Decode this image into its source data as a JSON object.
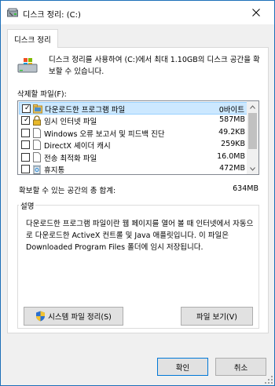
{
  "window": {
    "title": "디스크 정리: (C:)",
    "icons": {
      "title": "disk-cleanup-icon",
      "close": "close-icon"
    }
  },
  "tabs": [
    {
      "label": "디스크 정리",
      "active": true
    }
  ],
  "intro": {
    "icon": "drive-icon",
    "text": "디스크 정리를 사용하여 (C:)에서 최대 1.10GB의 디스크 공간을 확보할 수 있습니다."
  },
  "files_label": "삭제할 파일(F):",
  "files": [
    {
      "name": "다운로드한 프로그램 파일",
      "size": "0바이트",
      "checked": true,
      "selected": true,
      "icon": "folder-icon"
    },
    {
      "name": "임시 인터넷 파일",
      "size": "587MB",
      "checked": true,
      "selected": false,
      "icon": "lock-icon"
    },
    {
      "name": "Windows 오류 보고서 및 피드백 진단",
      "size": "49.2KB",
      "checked": false,
      "selected": false,
      "icon": "page-icon"
    },
    {
      "name": "DirectX 셰이더 캐시",
      "size": "259KB",
      "checked": false,
      "selected": false,
      "icon": "page-icon"
    },
    {
      "name": "전송 최적화 파일",
      "size": "16.0MB",
      "checked": false,
      "selected": false,
      "icon": "page-icon"
    },
    {
      "name": "휴지통",
      "size": "472MB",
      "checked": false,
      "selected": false,
      "icon": "recycle-bin-icon"
    }
  ],
  "total": {
    "label": "확보할 수 있는 공간의 총 합계:",
    "value": "634MB"
  },
  "description": {
    "title": "설명",
    "text": "다운로드한 프로그램 파일이란 웹 페이지를 열어 볼 때 인터넷에서 자동으로 다운로드한 ActiveX 컨트롤 및 Java 애플릿입니다. 이 파일은 Downloaded Program Files 폴더에 임시 저장됩니다."
  },
  "buttons": {
    "cleanup_system": "시스템 파일 정리(S)",
    "view_files": "파일 보기(V)",
    "ok": "확인",
    "cancel": "취소"
  },
  "colors": {
    "selection": "#cce8ff",
    "accent": "#0078d7"
  }
}
